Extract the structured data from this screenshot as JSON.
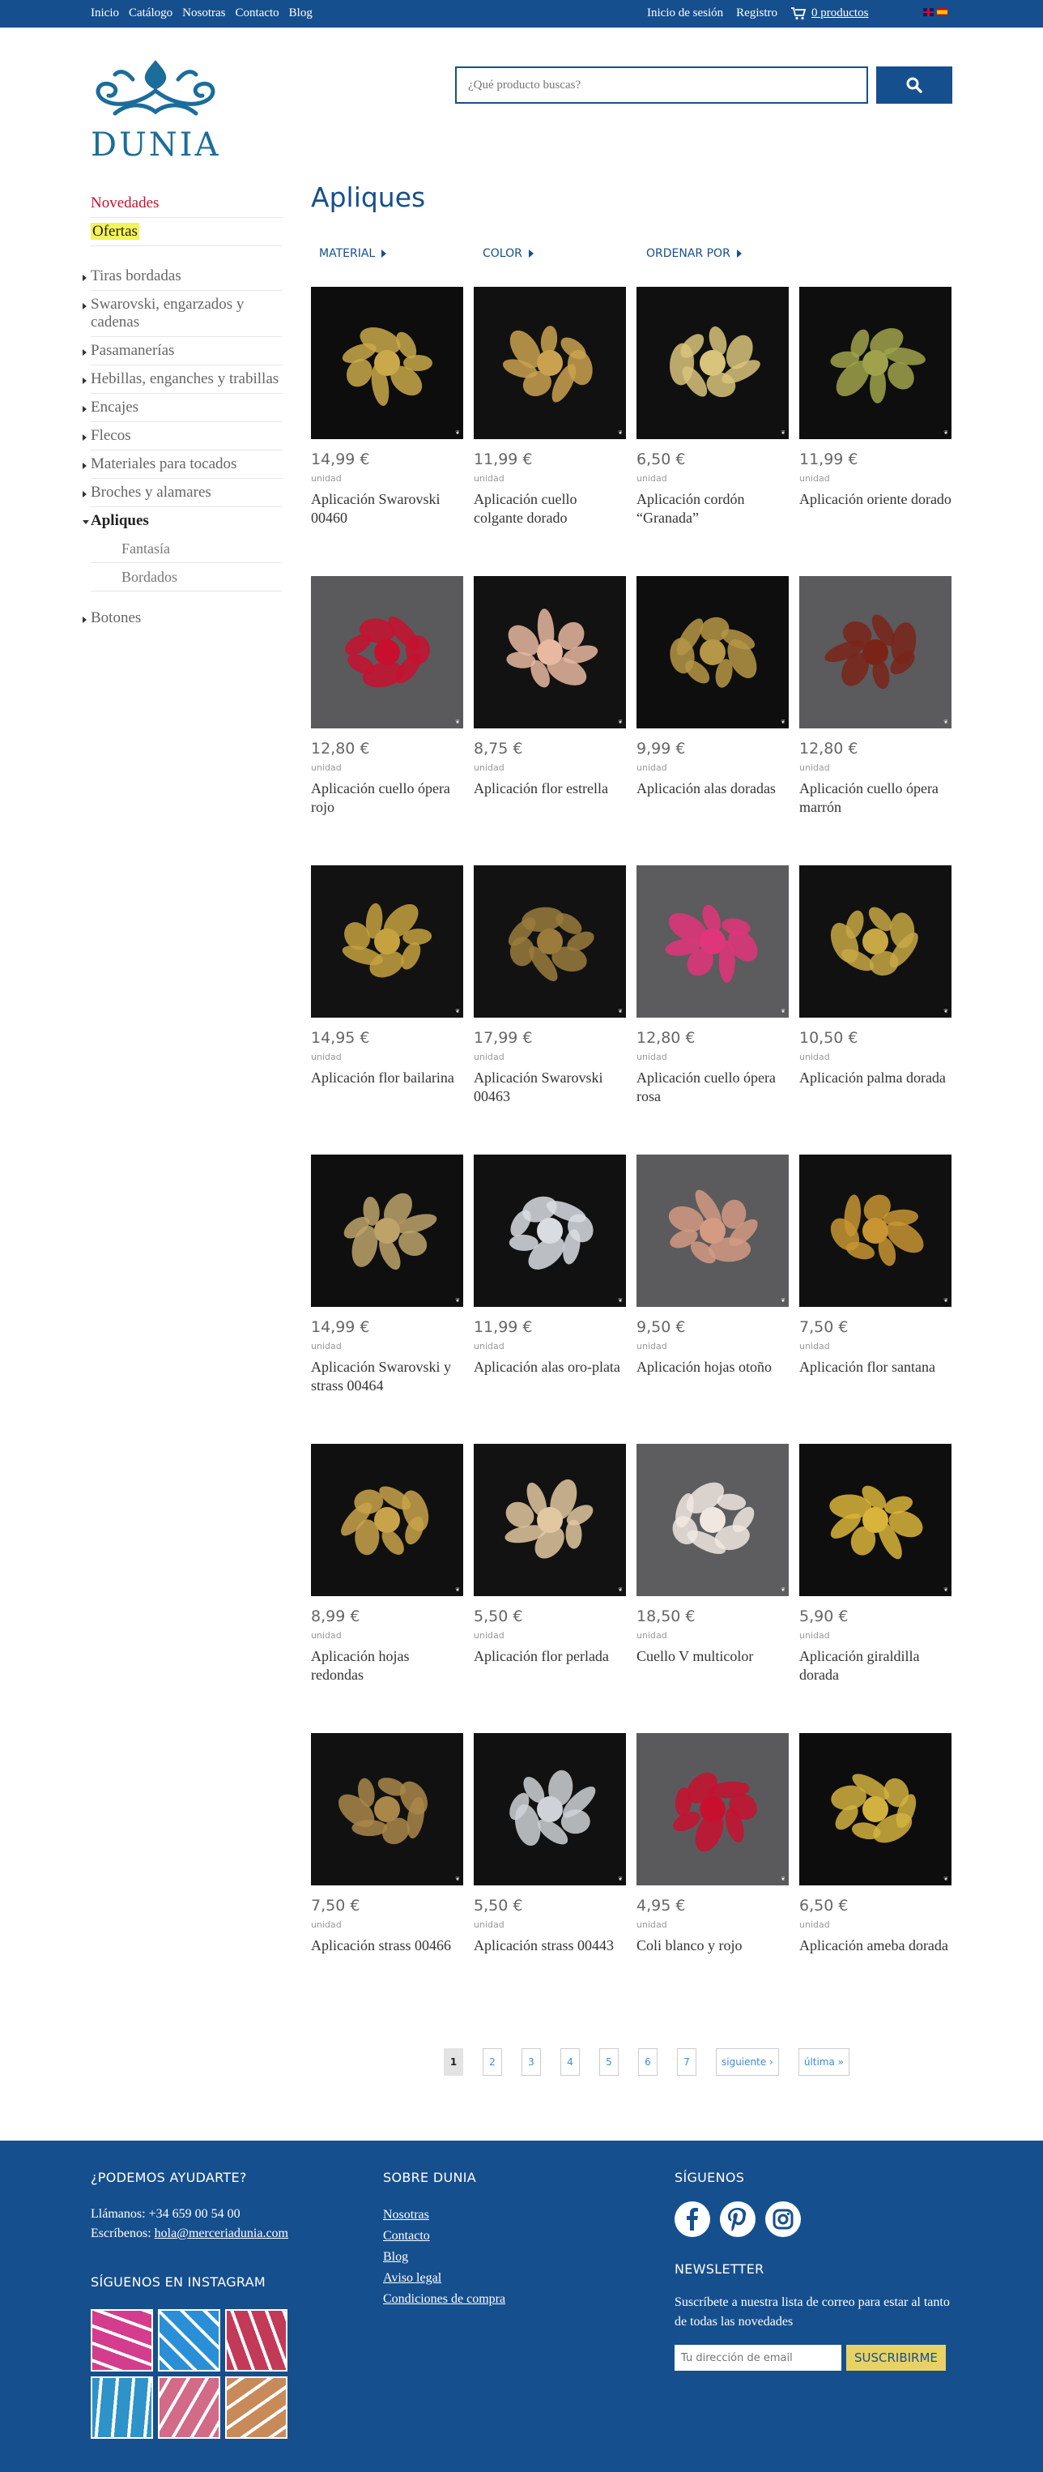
{
  "topbar": {
    "nav": [
      "Inicio",
      "Catálogo",
      "Nosotras",
      "Contacto",
      "Blog"
    ],
    "login": "Inicio de sesión",
    "register": "Registro",
    "cart": "0 productos",
    "cart_icon": "cart-icon",
    "flags": [
      "flag-en",
      "flag-es"
    ]
  },
  "header": {
    "logo_text": "DUNIA",
    "search_placeholder": "¿Qué producto buscas?",
    "search_icon": "search-icon"
  },
  "sidebar": {
    "highlights": [
      "Novedades",
      "Ofertas"
    ],
    "categories": [
      "Tiras bordadas",
      "Swarovski, engarzados y cadenas",
      "Pasamanerías",
      "Hebillas, enganches y trabillas",
      "Encajes",
      "Flecos",
      "Materiales para tocados",
      "Broches y alamares",
      "Apliques",
      "Botones"
    ],
    "subcategories": [
      "Fantasía",
      "Bordados"
    ]
  },
  "main": {
    "title": "Apliques",
    "filters": [
      "MATERIAL",
      "COLOR",
      "ORDENAR POR"
    ]
  },
  "products": [
    {
      "price": "14,99 €",
      "unit": "unidad",
      "name": "Aplicación Swarovski 00460"
    },
    {
      "price": "11,99 €",
      "unit": "unidad",
      "name": "Aplicación cuello colgante dorado"
    },
    {
      "price": "6,50 €",
      "unit": "unidad",
      "name": "Aplicación cordón “Granada”"
    },
    {
      "price": "11,99 €",
      "unit": "unidad",
      "name": "Aplicación oriente dorado"
    },
    {
      "price": "12,80 €",
      "unit": "unidad",
      "name": "Aplicación cuello ópera rojo"
    },
    {
      "price": "8,75 €",
      "unit": "unidad",
      "name": "Aplicación flor estrella"
    },
    {
      "price": "9,99 €",
      "unit": "unidad",
      "name": "Aplicación alas doradas"
    },
    {
      "price": "12,80 €",
      "unit": "unidad",
      "name": "Aplicación cuello ópera marrón"
    },
    {
      "price": "14,95 €",
      "unit": "unidad",
      "name": "Aplicación flor bailarina"
    },
    {
      "price": "17,99 €",
      "unit": "unidad",
      "name": "Aplicación Swarovski 00463"
    },
    {
      "price": "12,80 €",
      "unit": "unidad",
      "name": "Aplicación cuello ópera rosa"
    },
    {
      "price": "10,50 €",
      "unit": "unidad",
      "name": "Aplicación palma dorada"
    },
    {
      "price": "14,99 €",
      "unit": "unidad",
      "name": "Aplicación Swarovski y strass 00464"
    },
    {
      "price": "11,99 €",
      "unit": "unidad",
      "name": "Aplicación alas oro-plata"
    },
    {
      "price": "9,50 €",
      "unit": "unidad",
      "name": "Aplicación hojas otoño"
    },
    {
      "price": "7,50 €",
      "unit": "unidad",
      "name": "Aplicación flor santana"
    },
    {
      "price": "8,99 €",
      "unit": "unidad",
      "name": "Aplicación hojas redondas"
    },
    {
      "price": "5,50 €",
      "unit": "unidad",
      "name": "Aplicación flor perlada"
    },
    {
      "price": "18,50 €",
      "unit": "unidad",
      "name": "Cuello V multicolor"
    },
    {
      "price": "5,90 €",
      "unit": "unidad",
      "name": "Aplicación giraldilla dorada"
    },
    {
      "price": "7,50 €",
      "unit": "unidad",
      "name": "Aplicación strass 00466"
    },
    {
      "price": "5,50 €",
      "unit": "unidad",
      "name": "Aplicación strass 00443"
    },
    {
      "price": "4,95 €",
      "unit": "unidad",
      "name": "Coli blanco y rojo"
    },
    {
      "price": "6,50 €",
      "unit": "unidad",
      "name": "Aplicación ameba dorada"
    }
  ],
  "thumb_colors": [
    {
      "bg": "#0d0d0d",
      "fg": "#c9a94a"
    },
    {
      "bg": "#111111",
      "fg": "#caa24f"
    },
    {
      "bg": "#101010",
      "fg": "#d8c47a"
    },
    {
      "bg": "#0e0e0e",
      "fg": "#9fa24a"
    },
    {
      "bg": "#5a5a5c",
      "fg": "#c8102e"
    },
    {
      "bg": "#121212",
      "fg": "#e8b9a0"
    },
    {
      "bg": "#0e0e0e",
      "fg": "#b69647"
    },
    {
      "bg": "#5b5a5c",
      "fg": "#7a2418"
    },
    {
      "bg": "#121212",
      "fg": "#c6a140"
    },
    {
      "bg": "#121212",
      "fg": "#9a7b3c"
    },
    {
      "bg": "#5c5b5d",
      "fg": "#e0357a"
    },
    {
      "bg": "#111111",
      "fg": "#c8a845"
    },
    {
      "bg": "#0f0f0f",
      "fg": "#bda36a"
    },
    {
      "bg": "#111111",
      "fg": "#d9dde2"
    },
    {
      "bg": "#5b5b5d",
      "fg": "#d49a82"
    },
    {
      "bg": "#101010",
      "fg": "#c89532"
    },
    {
      "bg": "#101010",
      "fg": "#c9a34a"
    },
    {
      "bg": "#121212",
      "fg": "#e2c8a0"
    },
    {
      "bg": "#5d5d5f",
      "fg": "#f0e8e0"
    },
    {
      "bg": "#0e0e0e",
      "fg": "#d9b43a"
    },
    {
      "bg": "#111111",
      "fg": "#a9874a"
    },
    {
      "bg": "#111111",
      "fg": "#cfd2d6"
    },
    {
      "bg": "#5a5a5c",
      "fg": "#c8102e"
    },
    {
      "bg": "#0d0d0d",
      "fg": "#d2b23f"
    }
  ],
  "pagination": {
    "pages": [
      "1",
      "2",
      "3",
      "4",
      "5",
      "6",
      "7"
    ],
    "next": "siguiente ›",
    "last": "última »"
  },
  "footer": {
    "help_title": "¿PODEMOS AYUDARTE?",
    "phone": "Llámanos: +34 659 00 54 00",
    "email_prefix": "Escríbenos:",
    "email": "hola@merceriadunia.com",
    "instagram_title": "SÍGUENOS EN INSTAGRAM",
    "instagram_colors": [
      "#d43c8e",
      "#2a8fd6",
      "#c23a57",
      "#2d93c8",
      "#d26a88",
      "#c98a5a"
    ],
    "about_title": "SOBRE DUNIA",
    "about_links": [
      "Nosotras",
      "Contacto",
      "Blog",
      "Aviso legal",
      "Condiciones de compra"
    ],
    "follow_title": "SÍGUENOS",
    "social": [
      "facebook-icon",
      "pinterest-icon",
      "instagram-icon"
    ],
    "newsletter_title": "NEWSLETTER",
    "newsletter_text": "Suscríbete a nuestra lista de correo para estar al tanto de todas las novedades",
    "newsletter_placeholder": "Tu dirección de email",
    "subscribe": "SUSCRIBIRME"
  },
  "colors": {
    "brand": "#164f8e",
    "logo": "#1b6d9a",
    "accent_red": "#c8102e",
    "highlight": "#f3f35a",
    "subscribe_btn": "#e9d265"
  }
}
